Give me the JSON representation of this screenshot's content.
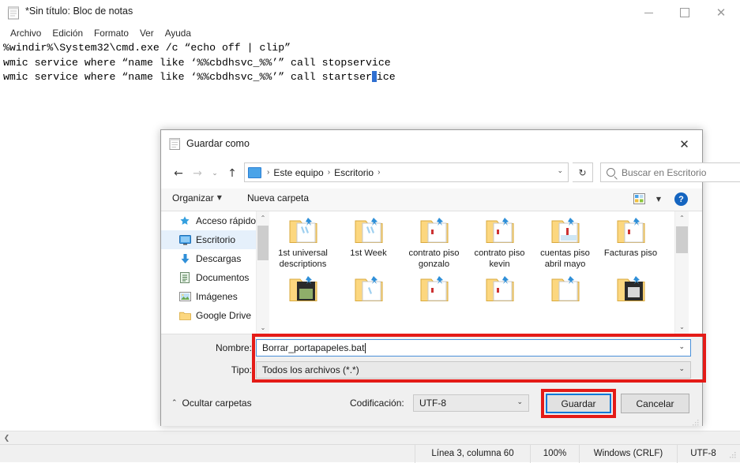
{
  "notepad": {
    "title": "*Sin título: Bloc de notas",
    "title_icon": "notepad-icon",
    "window_buttons": {
      "minimize": "minimize-icon",
      "maximize": "maximize-icon",
      "close": "close-icon"
    },
    "menu": [
      "Archivo",
      "Edición",
      "Formato",
      "Ver",
      "Ayuda"
    ],
    "content_lines": [
      "%windir%\\System32\\cmd.exe /c “echo off | clip”",
      "wmic service where “name like ‘%%cbdhsvc_%%’” call stopservice",
      "wmic service where “name like ‘%%cbdhsvc_%%’” call startser"
    ],
    "content_line3_tail": "ice",
    "status": {
      "position": "Línea 3, columna 60",
      "zoom": "100%",
      "line_endings": "Windows (CRLF)",
      "encoding": "UTF-8"
    }
  },
  "dialog": {
    "title": "Guardar como",
    "title_icon": "notepad-icon",
    "close_label": "✕",
    "nav": {
      "back": "←",
      "forward": "→",
      "recent": "⌄",
      "up": "↑",
      "breadcrumb": [
        "Este equipo",
        "Escritorio"
      ],
      "breadcrumb_separator": "›",
      "breadcrumb_caret": "⌄",
      "refresh": "↻",
      "search_placeholder": "Buscar en Escritorio"
    },
    "toolbar": {
      "organizar": "Organizar",
      "organizar_caret": "▼",
      "nueva_carpeta": "Nueva carpeta",
      "view_caret": "▼",
      "help": "?"
    },
    "sidebar": {
      "items": [
        {
          "label": "Acceso rápido",
          "icon": "star-icon",
          "pinned": false,
          "selected": false
        },
        {
          "label": "Escritorio",
          "icon": "desktop-icon",
          "pinned": true,
          "selected": true
        },
        {
          "label": "Descargas",
          "icon": "download-icon",
          "pinned": true,
          "selected": false
        },
        {
          "label": "Documentos",
          "icon": "document-icon",
          "pinned": true,
          "selected": false
        },
        {
          "label": "Imágenes",
          "icon": "picture-icon",
          "pinned": true,
          "selected": false
        },
        {
          "label": "Google Drive",
          "icon": "folder-icon",
          "pinned": true,
          "selected": false
        }
      ],
      "scroll_up": "⌃",
      "scroll_down": "⌄"
    },
    "files": {
      "row1": [
        {
          "name": "1st universal descriptions",
          "icon": "folder-shortcut-icon"
        },
        {
          "name": "1st Week",
          "icon": "folder-shortcut-icon"
        },
        {
          "name": "contrato piso gonzalo",
          "icon": "folder-shortcut-icon"
        },
        {
          "name": "contrato piso kevin",
          "icon": "folder-shortcut-icon"
        },
        {
          "name": "cuentas piso abril mayo",
          "icon": "folder-shortcut-icon"
        },
        {
          "name": "Facturas piso",
          "icon": "folder-shortcut-icon"
        }
      ],
      "row2": [
        {
          "name": "",
          "icon": "folder-shortcut-icon"
        },
        {
          "name": "",
          "icon": "folder-shortcut-icon"
        },
        {
          "name": "",
          "icon": "folder-shortcut-icon"
        },
        {
          "name": "",
          "icon": "folder-shortcut-icon"
        },
        {
          "name": "",
          "icon": "folder-shortcut-icon"
        },
        {
          "name": "",
          "icon": "folder-shortcut-icon"
        }
      ],
      "scroll_up": "⌃",
      "scroll_down": "⌄"
    },
    "form": {
      "nombre_label": "Nombre:",
      "nombre_value": "Borrar_portapapeles.bat",
      "tipo_label": "Tipo:",
      "tipo_value": "Todos los archivos  (*.*)",
      "dropdown_caret": "⌄"
    },
    "footer": {
      "ocultar_carpetas": "Ocultar carpetas",
      "ocultar_chevron": "⌃",
      "codificacion_label": "Codificación:",
      "codificacion_value": "UTF-8",
      "codificacion_caret": "⌄",
      "guardar": "Guardar",
      "cancelar": "Cancelar"
    }
  },
  "colors": {
    "highlight_red": "#e41b17",
    "focus_blue": "#0078d7",
    "selection_blue": "#e5f0fb",
    "caret_blue": "#2f6fd0"
  }
}
